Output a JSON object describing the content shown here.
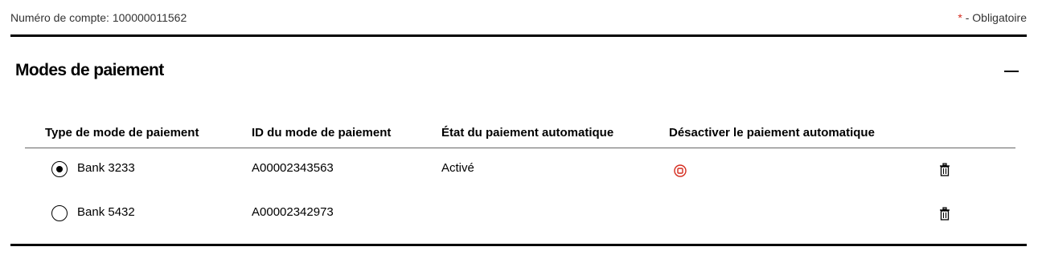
{
  "account": {
    "label": "Numéro de compte: 100000011562",
    "required_star": "*",
    "required_text": " - Obligatoire"
  },
  "section": {
    "title": "Modes de paiement"
  },
  "table": {
    "headers": [
      "Type de mode de paiement",
      "ID du mode de paiement",
      "État du paiement automatique",
      "Désactiver le paiement automatique"
    ],
    "rows": [
      {
        "type": "Bank 3233",
        "id": "A00002343563",
        "status": "Activé",
        "selected": true,
        "stop_icon": "stop-circle-icon",
        "delete_icon": "trash-icon"
      },
      {
        "type": "Bank 5432",
        "id": "A00002342973",
        "status": "",
        "selected": false,
        "delete_icon": "trash-icon"
      }
    ]
  },
  "colors": {
    "accent": "#d52b1e",
    "rule": "#000000",
    "header_rule": "#666666"
  }
}
